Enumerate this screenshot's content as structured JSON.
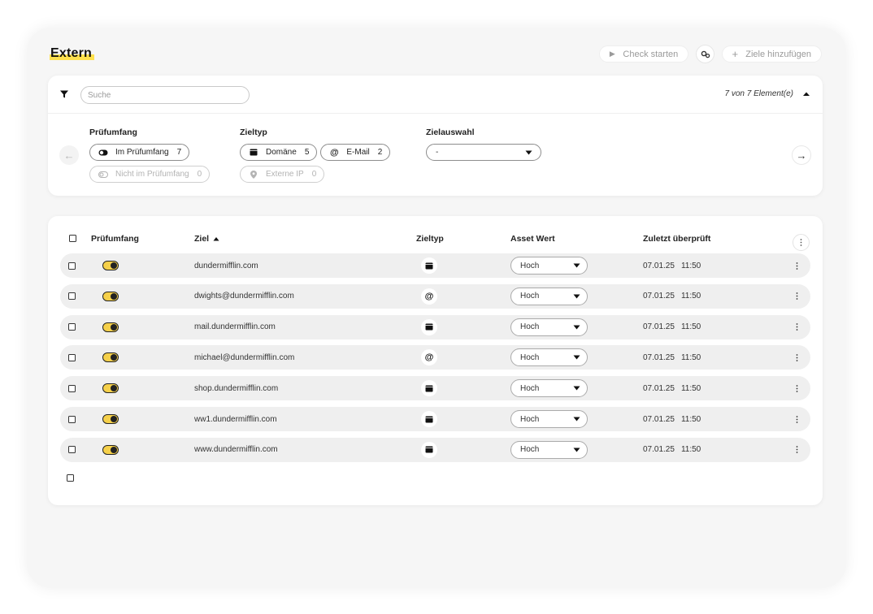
{
  "header": {
    "title": "Extern",
    "check_button": "Check starten",
    "add_button": "Ziele hinzufügen"
  },
  "filter": {
    "search_placeholder": "Suche",
    "count_text": "7 von 7 Element(e)",
    "groups": {
      "scope": {
        "title": "Prüfumfang",
        "in_label": "Im Prüfumfang",
        "in_count": "7",
        "out_label": "Nicht im Prüfumfang",
        "out_count": "0"
      },
      "target_type": {
        "title": "Zieltyp",
        "domain_label": "Domäne",
        "domain_count": "5",
        "email_label": "E-Mail",
        "email_count": "2",
        "ip_label": "Externe IP",
        "ip_count": "0"
      },
      "selection": {
        "title": "Zielauswahl",
        "value": "-"
      }
    }
  },
  "table": {
    "columns": {
      "scope": "Prüfumfang",
      "target": "Ziel",
      "type": "Zieltyp",
      "asset": "Asset Wert",
      "checked": "Zuletzt überprüft"
    },
    "rows": [
      {
        "target": "dundermifflin.com",
        "type": "domain",
        "asset": "Hoch",
        "date": "07.01.25",
        "time": "11:50"
      },
      {
        "target": "dwights@dundermifflin.com",
        "type": "email",
        "asset": "Hoch",
        "date": "07.01.25",
        "time": "11:50"
      },
      {
        "target": "mail.dundermifflin.com",
        "type": "domain",
        "asset": "Hoch",
        "date": "07.01.25",
        "time": "11:50"
      },
      {
        "target": "michael@dundermifflin.com",
        "type": "email",
        "asset": "Hoch",
        "date": "07.01.25",
        "time": "11:50"
      },
      {
        "target": "shop.dundermifflin.com",
        "type": "domain",
        "asset": "Hoch",
        "date": "07.01.25",
        "time": "11:50"
      },
      {
        "target": "ww1.dundermifflin.com",
        "type": "domain",
        "asset": "Hoch",
        "date": "07.01.25",
        "time": "11:50"
      },
      {
        "target": "www.dundermifflin.com",
        "type": "domain",
        "asset": "Hoch",
        "date": "07.01.25",
        "time": "11:50"
      }
    ]
  },
  "colors": {
    "accent": "#f5d04a",
    "highlight": "#ffe14d",
    "row_bg": "#efefef"
  }
}
